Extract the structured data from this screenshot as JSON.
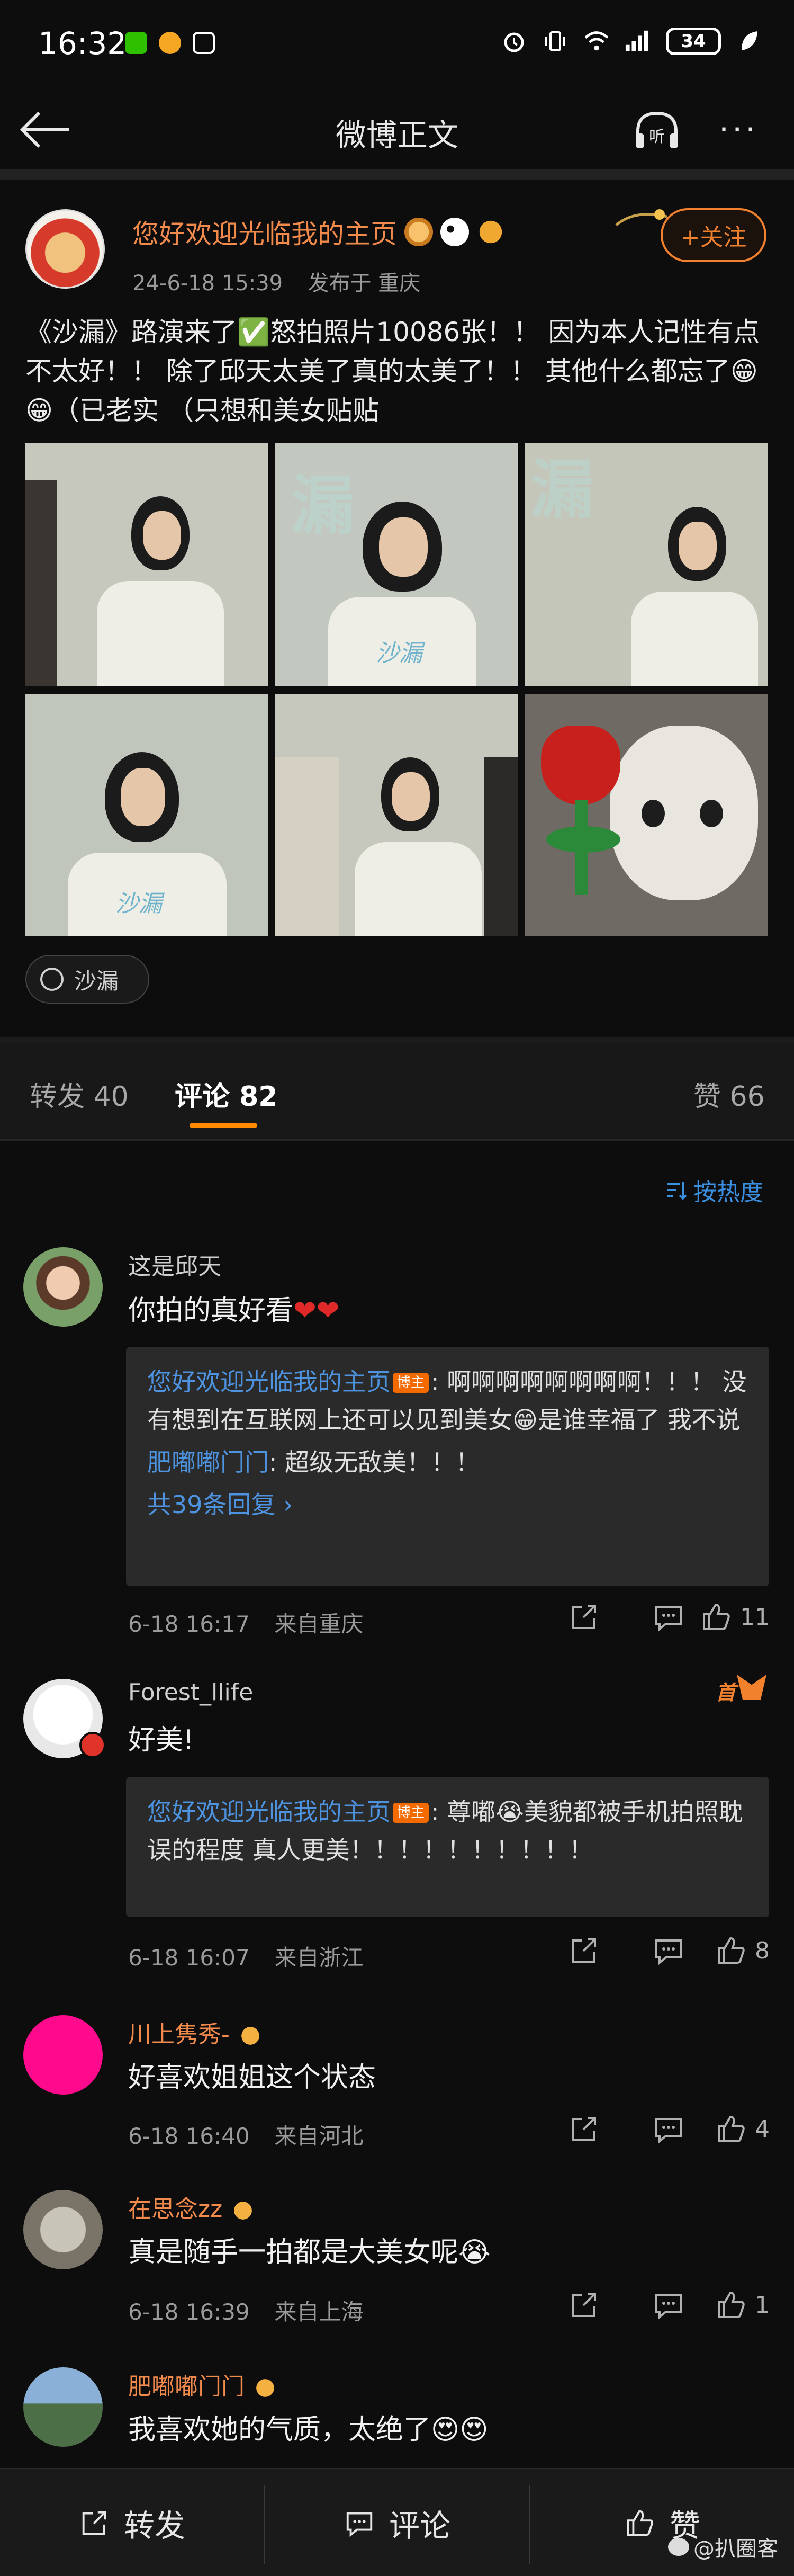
{
  "status_bar": {
    "time": "16:32",
    "battery": "34",
    "icons": [
      "wechat-icon",
      "weibo-notify-icon",
      "nfc-icon",
      "alarm-icon",
      "vibrate-icon",
      "wifi-icon",
      "signal-icon",
      "battery-icon",
      "eco-leaf-icon"
    ]
  },
  "nav": {
    "title": "微博正文",
    "listen_label": "听",
    "more_label": "···"
  },
  "post": {
    "author": "您好欢迎光临我的主页",
    "date": "24-6-18 15:39",
    "location": "发布于 重庆",
    "follow_label": "+关注",
    "text": "《沙漏》路演来了✅怒拍照片10086张！！ 因为本人记性有点不太好！！ 除了邱天太美了真的太美了！！ 其他什么都忘了😁😁（已老实 （只想和美女贴贴",
    "photos": [
      "photo-1",
      "photo-2",
      "photo-3",
      "photo-4",
      "photo-5",
      "photo-6"
    ],
    "topic": "沙漏",
    "photo_bg_text": "漏",
    "shirt_text": "沙漏"
  },
  "tabs": {
    "repost": "转发 40",
    "comment": "评论 82",
    "like": "赞 66",
    "sort": "按热度"
  },
  "comments": [
    {
      "name": "这是邱天",
      "text": "你拍的真好看",
      "hearts": "❤❤",
      "reply": {
        "author": "您好欢迎光临我的主页",
        "badge": "博主",
        "text": "啊啊啊啊啊啊啊啊！！！ 没有想到在互联网上还可以见到美女😁是谁幸福了 我不说",
        "sub_name": "肥嘟嘟门门",
        "sub_text": "超级无敌美！！！",
        "more": "共39条回复 ›"
      },
      "time": "6-18 16:17",
      "location": "来自重庆",
      "likes": "11"
    },
    {
      "name": "Forest_llife",
      "first_badge": "首",
      "text": "好美!",
      "reply": {
        "author": "您好欢迎光临我的主页",
        "badge": "博主",
        "text": "尊嘟😭美貌都被手机拍照耽误的程度 真人更美！！！！！！！！！！"
      },
      "time": "6-18 16:07",
      "location": "来自浙江",
      "likes": "8"
    },
    {
      "name": "川上隽秀-",
      "text": "好喜欢姐姐这个状态",
      "time": "6-18 16:40",
      "location": "来自河北",
      "likes": "4"
    },
    {
      "name": "在思念zz",
      "text": "真是随手一拍都是大美女呢😭",
      "time": "6-18 16:39",
      "location": "来自上海",
      "likes": "1"
    },
    {
      "name": "肥嘟嘟门门",
      "text": "我喜欢她的气质，太绝了😍😍"
    }
  ],
  "bottom_bar": {
    "repost": "转发",
    "comment": "评论",
    "like": "赞"
  },
  "watermark": "@扒圈客",
  "colors": {
    "accent_orange": "#f2812e",
    "link_blue": "#4d93e0",
    "tab_underline": "#ff8a00",
    "background": "#0d0d0d"
  }
}
